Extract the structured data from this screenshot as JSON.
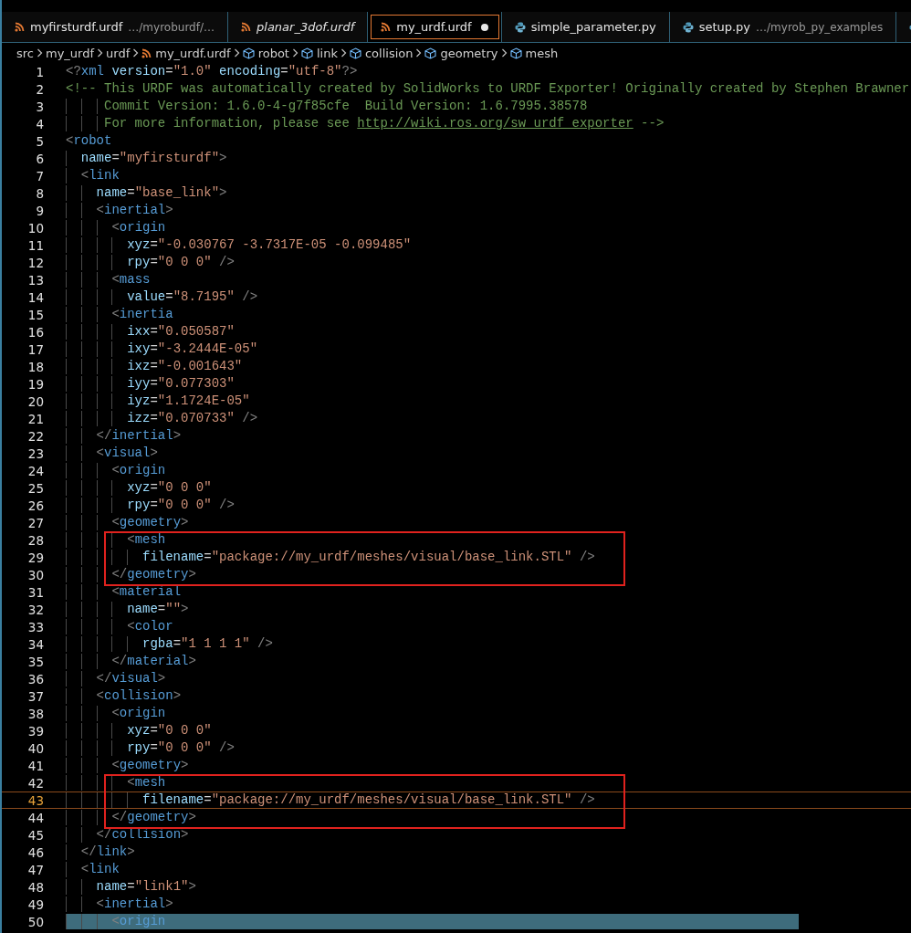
{
  "tabs": [
    {
      "label": "myfirsturdf.urdf",
      "description": "…/myroburdf/…",
      "kind": "rss",
      "selected": false,
      "preview": false,
      "modified": false
    },
    {
      "label": "planar_3dof.urdf",
      "kind": "rss",
      "selected": false,
      "preview": true,
      "modified": false
    },
    {
      "label": "my_urdf.urdf",
      "kind": "rss",
      "selected": true,
      "preview": false,
      "modified": true
    },
    {
      "label": "simple_parameter.py",
      "kind": "python",
      "selected": false,
      "preview": false,
      "modified": false
    },
    {
      "label": "setup.py",
      "description": "…/myrob_py_examples",
      "kind": "python",
      "selected": false,
      "preview": false,
      "modified": false
    },
    {
      "kind": "python",
      "selected": false,
      "preview": false,
      "modified": false
    }
  ],
  "breadcrumb": [
    {
      "label": "src",
      "kind": "folder"
    },
    {
      "label": "my_urdf",
      "kind": "folder"
    },
    {
      "label": "urdf",
      "kind": "folder"
    },
    {
      "label": "my_urdf.urdf",
      "kind": "rss"
    },
    {
      "label": "robot",
      "kind": "cube"
    },
    {
      "label": "link",
      "kind": "cube"
    },
    {
      "label": "collision",
      "kind": "cube"
    },
    {
      "label": "geometry",
      "kind": "cube"
    },
    {
      "label": "mesh",
      "kind": "cube"
    }
  ],
  "lines": [
    {
      "number": "1",
      "text": "<?xml version=\"1.0\" encoding=\"utf-8\"?>"
    },
    {
      "number": "2",
      "text": "<!-- This URDF was automatically created by SolidWorks to URDF Exporter! Originally created by Stephen Brawner"
    },
    {
      "number": "3",
      "text": "     Commit Version: 1.6.0-4-g7f85cfe  Build Version: 1.6.7995.38578"
    },
    {
      "number": "4",
      "text": "     For more information, please see http://wiki.ros.org/sw_urdf_exporter -->"
    },
    {
      "number": "5",
      "text": "<robot"
    },
    {
      "number": "6",
      "text": "  name=\"myfirsturdf\">"
    },
    {
      "number": "7",
      "text": "  <link"
    },
    {
      "number": "8",
      "text": "    name=\"base_link\">"
    },
    {
      "number": "9",
      "text": "    <inertial>"
    },
    {
      "number": "10",
      "text": "      <origin"
    },
    {
      "number": "11",
      "text": "        xyz=\"-0.030767 -3.7317E-05 -0.099485\""
    },
    {
      "number": "12",
      "text": "        rpy=\"0 0 0\" />"
    },
    {
      "number": "13",
      "text": "      <mass"
    },
    {
      "number": "14",
      "text": "        value=\"8.7195\" />"
    },
    {
      "number": "15",
      "text": "      <inertia"
    },
    {
      "number": "16",
      "text": "        ixx=\"0.050587\""
    },
    {
      "number": "17",
      "text": "        ixy=\"-3.2444E-05\""
    },
    {
      "number": "18",
      "text": "        ixz=\"-0.001643\""
    },
    {
      "number": "19",
      "text": "        iyy=\"0.077303\""
    },
    {
      "number": "20",
      "text": "        iyz=\"1.1724E-05\""
    },
    {
      "number": "21",
      "text": "        izz=\"0.070733\" />"
    },
    {
      "number": "22",
      "text": "    </inertial>"
    },
    {
      "number": "23",
      "text": "    <visual>"
    },
    {
      "number": "24",
      "text": "      <origin"
    },
    {
      "number": "25",
      "text": "        xyz=\"0 0 0\""
    },
    {
      "number": "26",
      "text": "        rpy=\"0 0 0\" />"
    },
    {
      "number": "27",
      "text": "      <geometry>"
    },
    {
      "number": "28",
      "text": "        <mesh",
      "boxed": true
    },
    {
      "number": "29",
      "text": "          filename=\"package://my_urdf/meshes/visual/base_link.STL\" />",
      "boxed": true
    },
    {
      "number": "30",
      "text": "      </geometry>",
      "boxed": true
    },
    {
      "number": "31",
      "text": "      <material"
    },
    {
      "number": "32",
      "text": "        name=\"\">"
    },
    {
      "number": "33",
      "text": "        <color"
    },
    {
      "number": "34",
      "text": "          rgba=\"1 1 1 1\" />"
    },
    {
      "number": "35",
      "text": "      </material>"
    },
    {
      "number": "36",
      "text": "    </visual>"
    },
    {
      "number": "37",
      "text": "    <collision>"
    },
    {
      "number": "38",
      "text": "      <origin"
    },
    {
      "number": "39",
      "text": "        xyz=\"0 0 0\""
    },
    {
      "number": "40",
      "text": "        rpy=\"0 0 0\" />"
    },
    {
      "number": "41",
      "text": "      <geometry>"
    },
    {
      "number": "42",
      "text": "        <mesh",
      "boxed": true
    },
    {
      "number": "43",
      "text": "          filename=\"package://my_urdf/meshes/visual/base_link.STL\" />",
      "boxed": true,
      "current": true
    },
    {
      "number": "44",
      "text": "      </geometry>",
      "boxed": true
    },
    {
      "number": "45",
      "text": "    </collision>"
    },
    {
      "number": "46",
      "text": "  </link>"
    },
    {
      "number": "47",
      "text": "  <link"
    },
    {
      "number": "48",
      "text": "    name=\"link1\">"
    },
    {
      "number": "49",
      "text": "    <inertial>"
    },
    {
      "number": "50",
      "text": "      <origin",
      "highlighted": true
    }
  ]
}
